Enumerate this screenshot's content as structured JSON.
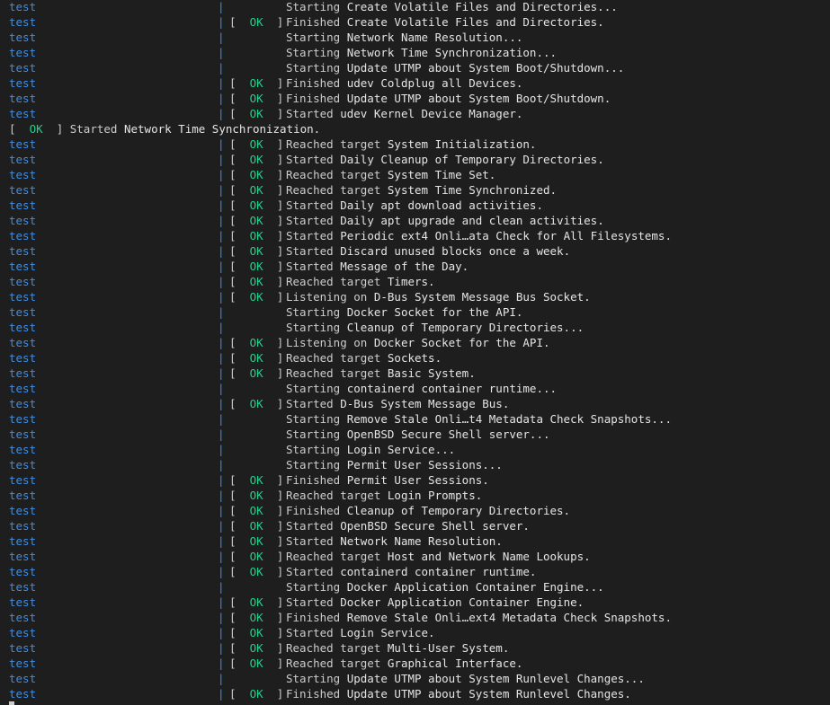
{
  "terminal": {
    "service": "test",
    "separator": "|",
    "ok_open": "[  ",
    "ok_label": "OK",
    "ok_close": "  ]",
    "lines": [
      {
        "kind": "svc",
        "status": "",
        "action": "Starting",
        "target": "Create Volatile Files and Directories..."
      },
      {
        "kind": "svc",
        "status": "ok",
        "action": "Finished",
        "target": "Create Volatile Files and Directories."
      },
      {
        "kind": "svc",
        "status": "",
        "action": "Starting",
        "target": "Network Name Resolution..."
      },
      {
        "kind": "svc",
        "status": "",
        "action": "Starting",
        "target": "Network Time Synchronization..."
      },
      {
        "kind": "svc",
        "status": "",
        "action": "Starting",
        "target": "Update UTMP about System Boot/Shutdown..."
      },
      {
        "kind": "svc",
        "status": "ok",
        "action": "Finished",
        "target": "udev Coldplug all Devices."
      },
      {
        "kind": "svc",
        "status": "ok",
        "action": "Finished",
        "target": "Update UTMP about System Boot/Shutdown."
      },
      {
        "kind": "svc",
        "status": "ok",
        "action": "Started",
        "target": "udev Kernel Device Manager."
      },
      {
        "kind": "plain",
        "status": "ok",
        "action": "Started",
        "target": "Network Time Synchronization."
      },
      {
        "kind": "svc",
        "status": "ok",
        "action": "Reached target",
        "target": "System Initialization."
      },
      {
        "kind": "svc",
        "status": "ok",
        "action": "Started",
        "target": "Daily Cleanup of Temporary Directories."
      },
      {
        "kind": "svc",
        "status": "ok",
        "action": "Reached target",
        "target": "System Time Set."
      },
      {
        "kind": "svc",
        "status": "ok",
        "action": "Reached target",
        "target": "System Time Synchronized."
      },
      {
        "kind": "svc",
        "status": "ok",
        "action": "Started",
        "target": "Daily apt download activities."
      },
      {
        "kind": "svc",
        "status": "ok",
        "action": "Started",
        "target": "Daily apt upgrade and clean activities."
      },
      {
        "kind": "svc",
        "status": "ok",
        "action": "Started",
        "target": "Periodic ext4 Onli…ata Check for All Filesystems."
      },
      {
        "kind": "svc",
        "status": "ok",
        "action": "Started",
        "target": "Discard unused blocks once a week."
      },
      {
        "kind": "svc",
        "status": "ok",
        "action": "Started",
        "target": "Message of the Day."
      },
      {
        "kind": "svc",
        "status": "ok",
        "action": "Reached target",
        "target": "Timers."
      },
      {
        "kind": "svc",
        "status": "ok",
        "action": "Listening on",
        "target": "D-Bus System Message Bus Socket."
      },
      {
        "kind": "svc",
        "status": "",
        "action": "Starting",
        "target": "Docker Socket for the API."
      },
      {
        "kind": "svc",
        "status": "",
        "action": "Starting",
        "target": "Cleanup of Temporary Directories..."
      },
      {
        "kind": "svc",
        "status": "ok",
        "action": "Listening on",
        "target": "Docker Socket for the API."
      },
      {
        "kind": "svc",
        "status": "ok",
        "action": "Reached target",
        "target": "Sockets."
      },
      {
        "kind": "svc",
        "status": "ok",
        "action": "Reached target",
        "target": "Basic System."
      },
      {
        "kind": "svc",
        "status": "",
        "action": "Starting",
        "target": "containerd container runtime..."
      },
      {
        "kind": "svc",
        "status": "ok",
        "action": "Started",
        "target": "D-Bus System Message Bus."
      },
      {
        "kind": "svc",
        "status": "",
        "action": "Starting",
        "target": "Remove Stale Onli…t4 Metadata Check Snapshots..."
      },
      {
        "kind": "svc",
        "status": "",
        "action": "Starting",
        "target": "OpenBSD Secure Shell server..."
      },
      {
        "kind": "svc",
        "status": "",
        "action": "Starting",
        "target": "Login Service..."
      },
      {
        "kind": "svc",
        "status": "",
        "action": "Starting",
        "target": "Permit User Sessions..."
      },
      {
        "kind": "svc",
        "status": "ok",
        "action": "Finished",
        "target": "Permit User Sessions."
      },
      {
        "kind": "svc",
        "status": "ok",
        "action": "Reached target",
        "target": "Login Prompts."
      },
      {
        "kind": "svc",
        "status": "ok",
        "action": "Finished",
        "target": "Cleanup of Temporary Directories."
      },
      {
        "kind": "svc",
        "status": "ok",
        "action": "Started",
        "target": "OpenBSD Secure Shell server."
      },
      {
        "kind": "svc",
        "status": "ok",
        "action": "Started",
        "target": "Network Name Resolution."
      },
      {
        "kind": "svc",
        "status": "ok",
        "action": "Reached target",
        "target": "Host and Network Name Lookups."
      },
      {
        "kind": "svc",
        "status": "ok",
        "action": "Started",
        "target": "containerd container runtime."
      },
      {
        "kind": "svc",
        "status": "",
        "action": "Starting",
        "target": "Docker Application Container Engine..."
      },
      {
        "kind": "svc",
        "status": "ok",
        "action": "Started",
        "target": "Docker Application Container Engine."
      },
      {
        "kind": "svc",
        "status": "ok",
        "action": "Finished",
        "target": "Remove Stale Onli…ext4 Metadata Check Snapshots."
      },
      {
        "kind": "svc",
        "status": "ok",
        "action": "Started",
        "target": "Login Service."
      },
      {
        "kind": "svc",
        "status": "ok",
        "action": "Reached target",
        "target": "Multi-User System."
      },
      {
        "kind": "svc",
        "status": "ok",
        "action": "Reached target",
        "target": "Graphical Interface."
      },
      {
        "kind": "svc",
        "status": "",
        "action": "Starting",
        "target": "Update UTMP about System Runlevel Changes..."
      },
      {
        "kind": "svc",
        "status": "ok",
        "action": "Finished",
        "target": "Update UTMP about System Runlevel Changes."
      }
    ]
  },
  "colors": {
    "background": "#1e1e1e",
    "service": "#3b8eea",
    "ok": "#23d18b",
    "text": "#cccccc"
  }
}
